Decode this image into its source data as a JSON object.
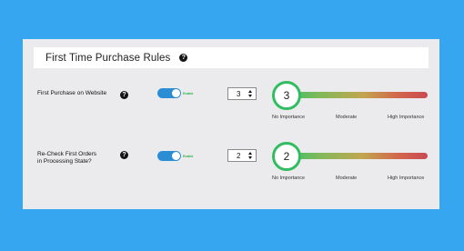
{
  "panel": {
    "title": "First Time Purchase Rules",
    "help_icon": "question-circle-icon"
  },
  "rules": [
    {
      "label_lines": [
        "First Purchase on Website"
      ],
      "toggle_text": "Enable",
      "toggle_on": true,
      "stepper_value": "3",
      "importance": "3",
      "scale": [
        "No Importance",
        "Moderate",
        "High Importance"
      ]
    },
    {
      "label_lines": [
        "Re-Check First Orders",
        "in Processing State?"
      ],
      "toggle_text": "Enable",
      "toggle_on": true,
      "stepper_value": "2",
      "importance": "2",
      "scale": [
        "No Importance",
        "Moderate",
        "High Importance"
      ]
    }
  ],
  "colors": {
    "background": "#35a6ef",
    "panel": "#ebebed",
    "toggle_on": "#2b8dd4",
    "thumb_border": "#33bd62"
  }
}
